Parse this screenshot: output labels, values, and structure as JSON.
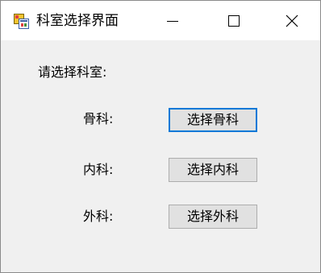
{
  "window": {
    "title": "科室选择界面",
    "icon": "winforms-app-icon"
  },
  "caption_buttons": {
    "minimize": "minimize-icon",
    "maximize": "maximize-icon",
    "close": "close-icon"
  },
  "form": {
    "prompt": "请选择科室:",
    "departments": [
      {
        "label": "骨科:",
        "button": "选择骨科",
        "focused": true
      },
      {
        "label": "内科:",
        "button": "选择内科",
        "focused": false
      },
      {
        "label": "外科:",
        "button": "选择外科",
        "focused": false
      }
    ]
  },
  "colors": {
    "focus_border": "#0078d7",
    "button_face": "#e1e1e1",
    "window_bg": "#f0f0f0"
  }
}
